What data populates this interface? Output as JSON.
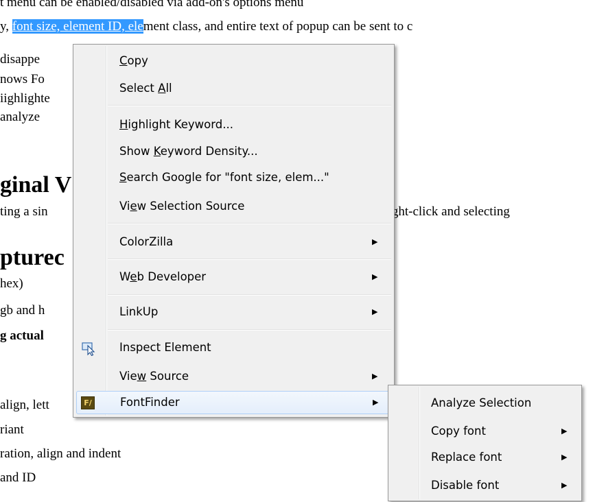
{
  "page": {
    "lines": [
      {
        "pre": "t menu can be enabled/disabled via add-on's options menu"
      },
      {
        "pre": "y, ",
        "sel_link": "font size, element ID, ele",
        "post": "ment class, and entire text of popup can be sent to c"
      },
      {
        "pre": " disappe"
      },
      {
        "pre": "nows Fo"
      },
      {
        "pre": "iighlighte"
      },
      {
        "pre": " analyze"
      },
      {
        "pre": "ginal V"
      },
      {
        "pre": "ting a sin",
        "post": "ng ), right-click and selecting"
      },
      {
        "pre": "pturec"
      },
      {
        "pre": "hex)"
      },
      {
        "pre": "gb and h"
      },
      {
        "pre": "g actual"
      },
      {
        "pre": "align, lett"
      },
      {
        "pre": "riant"
      },
      {
        "pre": "ration, align and indent"
      },
      {
        "pre": " and ID"
      }
    ]
  },
  "context_menu": {
    "copy": {
      "pre": "",
      "acc": "C",
      "post": "opy"
    },
    "select_all": {
      "pre": "Select ",
      "acc": "A",
      "post": "ll"
    },
    "highlight": {
      "pre": "",
      "acc": "H",
      "post": "ighlight Keyword..."
    },
    "density": {
      "pre": "Show ",
      "acc": "K",
      "post": "eyword Density..."
    },
    "search": {
      "pre": "",
      "acc": "S",
      "post": "earch Google for \"font size, elem...\""
    },
    "view_sel": {
      "pre": "Vi",
      "acc": "e",
      "post": "w Selection Source"
    },
    "colorzilla": "ColorZilla",
    "webdev": {
      "pre": "W",
      "acc": "e",
      "post": "b Developer"
    },
    "linkup": "LinkUp",
    "inspect": "Inspect Element",
    "view_source": {
      "pre": "Vie",
      "acc": "w",
      "post": " Source"
    },
    "fontfinder": "FontFinder",
    "arrow": "▶"
  },
  "submenu": {
    "analyze": "Analyze Selection",
    "copy_font": "Copy font",
    "replace_font": "Replace font",
    "disable_font": "Disable font"
  },
  "icons": {
    "inspect_icon": "cursor-box-icon",
    "fontfinder_icon": "fontfinder-logo-icon",
    "fontfinder_text": "F/"
  }
}
